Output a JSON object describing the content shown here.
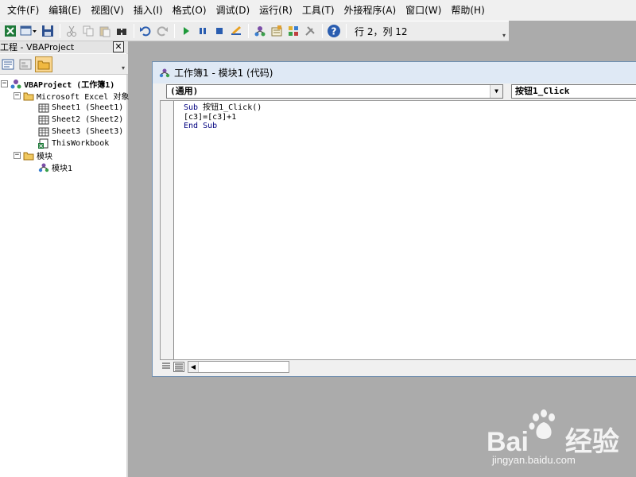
{
  "menu": {
    "items": [
      "文件(F)",
      "编辑(E)",
      "视图(V)",
      "插入(I)",
      "格式(O)",
      "调试(D)",
      "运行(R)",
      "工具(T)",
      "外接程序(A)",
      "窗口(W)",
      "帮助(H)"
    ]
  },
  "toolbar": {
    "status": "行 2，列 12"
  },
  "project": {
    "title": "工程 - VBAProject",
    "close_label": "✕",
    "root": "VBAProject (工作簿1)",
    "objects_folder": "Microsoft Excel 对象",
    "sheets": [
      "Sheet1 (Sheet1)",
      "Sheet2 (Sheet2)",
      "Sheet3 (Sheet3)"
    ],
    "workbook": "ThisWorkbook",
    "modules_folder": "模块",
    "module": "模块1"
  },
  "code_window": {
    "title": "工作簿1 - 模块1 (代码)",
    "object_combo": "(通用)",
    "proc_combo": "按钮1_Click",
    "lines": {
      "line1_kw": "Sub",
      "line1_rest": " 按钮1_Click()",
      "line2": "[c3]=[c3]+1",
      "line3_kw": "End Sub"
    }
  },
  "watermark": {
    "brand_left": "Bai",
    "brand_right": "经验",
    "url": "jingyan.baidu.com"
  },
  "colors": {
    "keyword": "#00007f",
    "workspace": "#ababab",
    "titlebar": "#dfe9f5"
  }
}
